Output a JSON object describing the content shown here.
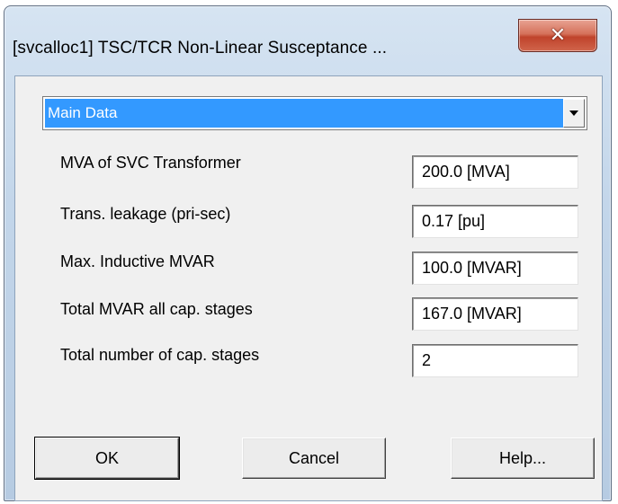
{
  "window": {
    "title": "[svcalloc1] TSC/TCR Non-Linear Susceptance ..."
  },
  "section_select": {
    "value": "Main Data"
  },
  "params": [
    {
      "label": "MVA of SVC Transformer",
      "value": "200.0 [MVA]"
    },
    {
      "label": "Trans. leakage (pri-sec)",
      "value": "0.17 [pu]"
    },
    {
      "label": "Max. Inductive MVAR",
      "value": "100.0 [MVAR]"
    },
    {
      "label": "Total MVAR all cap. stages",
      "value": "167.0 [MVAR]"
    },
    {
      "label": "Total number of cap. stages",
      "value": "2"
    }
  ],
  "buttons": {
    "ok": "OK",
    "cancel": "Cancel",
    "help": "Help..."
  },
  "icons": {
    "close": "close-icon",
    "dropdown": "chevron-down-icon"
  },
  "colors": {
    "selection": "#3399ff",
    "close_button": "#c0432b"
  }
}
